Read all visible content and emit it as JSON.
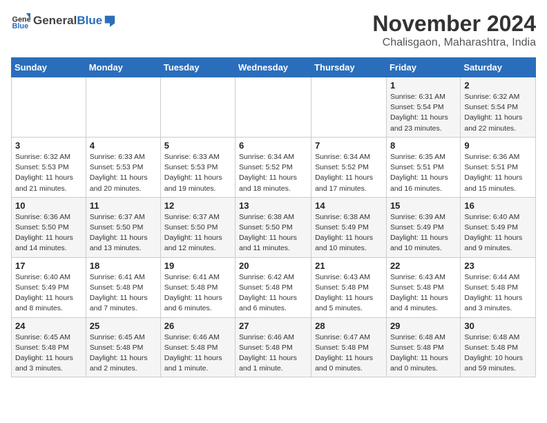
{
  "header": {
    "logo_general": "General",
    "logo_blue": "Blue",
    "title": "November 2024",
    "subtitle": "Chalisgaon, Maharashtra, India"
  },
  "weekdays": [
    "Sunday",
    "Monday",
    "Tuesday",
    "Wednesday",
    "Thursday",
    "Friday",
    "Saturday"
  ],
  "weeks": [
    [
      {
        "day": "",
        "info": ""
      },
      {
        "day": "",
        "info": ""
      },
      {
        "day": "",
        "info": ""
      },
      {
        "day": "",
        "info": ""
      },
      {
        "day": "",
        "info": ""
      },
      {
        "day": "1",
        "info": "Sunrise: 6:31 AM\nSunset: 5:54 PM\nDaylight: 11 hours\nand 23 minutes."
      },
      {
        "day": "2",
        "info": "Sunrise: 6:32 AM\nSunset: 5:54 PM\nDaylight: 11 hours\nand 22 minutes."
      }
    ],
    [
      {
        "day": "3",
        "info": "Sunrise: 6:32 AM\nSunset: 5:53 PM\nDaylight: 11 hours\nand 21 minutes."
      },
      {
        "day": "4",
        "info": "Sunrise: 6:33 AM\nSunset: 5:53 PM\nDaylight: 11 hours\nand 20 minutes."
      },
      {
        "day": "5",
        "info": "Sunrise: 6:33 AM\nSunset: 5:53 PM\nDaylight: 11 hours\nand 19 minutes."
      },
      {
        "day": "6",
        "info": "Sunrise: 6:34 AM\nSunset: 5:52 PM\nDaylight: 11 hours\nand 18 minutes."
      },
      {
        "day": "7",
        "info": "Sunrise: 6:34 AM\nSunset: 5:52 PM\nDaylight: 11 hours\nand 17 minutes."
      },
      {
        "day": "8",
        "info": "Sunrise: 6:35 AM\nSunset: 5:51 PM\nDaylight: 11 hours\nand 16 minutes."
      },
      {
        "day": "9",
        "info": "Sunrise: 6:36 AM\nSunset: 5:51 PM\nDaylight: 11 hours\nand 15 minutes."
      }
    ],
    [
      {
        "day": "10",
        "info": "Sunrise: 6:36 AM\nSunset: 5:50 PM\nDaylight: 11 hours\nand 14 minutes."
      },
      {
        "day": "11",
        "info": "Sunrise: 6:37 AM\nSunset: 5:50 PM\nDaylight: 11 hours\nand 13 minutes."
      },
      {
        "day": "12",
        "info": "Sunrise: 6:37 AM\nSunset: 5:50 PM\nDaylight: 11 hours\nand 12 minutes."
      },
      {
        "day": "13",
        "info": "Sunrise: 6:38 AM\nSunset: 5:50 PM\nDaylight: 11 hours\nand 11 minutes."
      },
      {
        "day": "14",
        "info": "Sunrise: 6:38 AM\nSunset: 5:49 PM\nDaylight: 11 hours\nand 10 minutes."
      },
      {
        "day": "15",
        "info": "Sunrise: 6:39 AM\nSunset: 5:49 PM\nDaylight: 11 hours\nand 10 minutes."
      },
      {
        "day": "16",
        "info": "Sunrise: 6:40 AM\nSunset: 5:49 PM\nDaylight: 11 hours\nand 9 minutes."
      }
    ],
    [
      {
        "day": "17",
        "info": "Sunrise: 6:40 AM\nSunset: 5:49 PM\nDaylight: 11 hours\nand 8 minutes."
      },
      {
        "day": "18",
        "info": "Sunrise: 6:41 AM\nSunset: 5:48 PM\nDaylight: 11 hours\nand 7 minutes."
      },
      {
        "day": "19",
        "info": "Sunrise: 6:41 AM\nSunset: 5:48 PM\nDaylight: 11 hours\nand 6 minutes."
      },
      {
        "day": "20",
        "info": "Sunrise: 6:42 AM\nSunset: 5:48 PM\nDaylight: 11 hours\nand 6 minutes."
      },
      {
        "day": "21",
        "info": "Sunrise: 6:43 AM\nSunset: 5:48 PM\nDaylight: 11 hours\nand 5 minutes."
      },
      {
        "day": "22",
        "info": "Sunrise: 6:43 AM\nSunset: 5:48 PM\nDaylight: 11 hours\nand 4 minutes."
      },
      {
        "day": "23",
        "info": "Sunrise: 6:44 AM\nSunset: 5:48 PM\nDaylight: 11 hours\nand 3 minutes."
      }
    ],
    [
      {
        "day": "24",
        "info": "Sunrise: 6:45 AM\nSunset: 5:48 PM\nDaylight: 11 hours\nand 3 minutes."
      },
      {
        "day": "25",
        "info": "Sunrise: 6:45 AM\nSunset: 5:48 PM\nDaylight: 11 hours\nand 2 minutes."
      },
      {
        "day": "26",
        "info": "Sunrise: 6:46 AM\nSunset: 5:48 PM\nDaylight: 11 hours\nand 1 minute."
      },
      {
        "day": "27",
        "info": "Sunrise: 6:46 AM\nSunset: 5:48 PM\nDaylight: 11 hours\nand 1 minute."
      },
      {
        "day": "28",
        "info": "Sunrise: 6:47 AM\nSunset: 5:48 PM\nDaylight: 11 hours\nand 0 minutes."
      },
      {
        "day": "29",
        "info": "Sunrise: 6:48 AM\nSunset: 5:48 PM\nDaylight: 11 hours\nand 0 minutes."
      },
      {
        "day": "30",
        "info": "Sunrise: 6:48 AM\nSunset: 5:48 PM\nDaylight: 10 hours\nand 59 minutes."
      }
    ]
  ]
}
